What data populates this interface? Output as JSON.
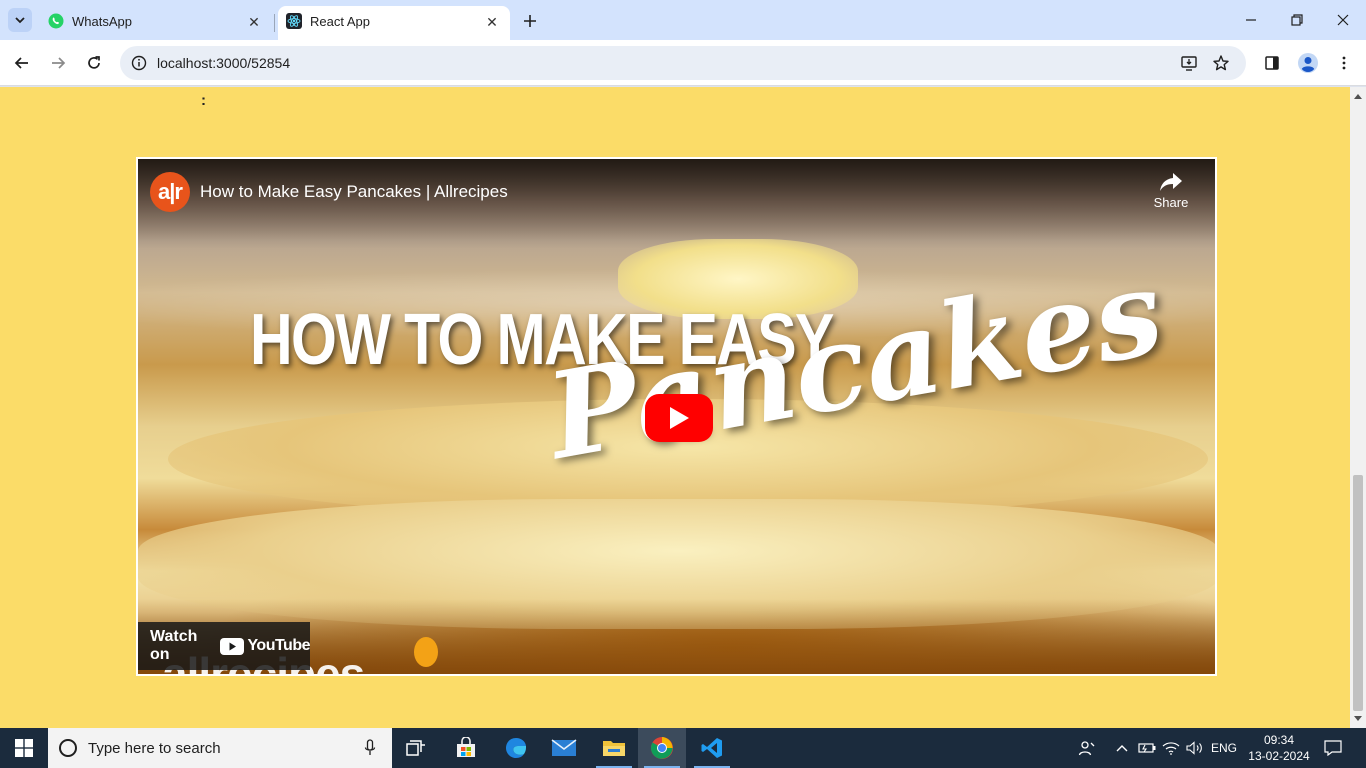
{
  "browser": {
    "tabs": [
      {
        "title": "WhatsApp",
        "favicon": "whatsapp-icon",
        "active": false
      },
      {
        "title": "React App",
        "favicon": "react-icon",
        "active": true
      }
    ],
    "url": "localhost:3000/52854"
  },
  "page": {
    "colon_text": ":",
    "background_color": "#fbdc68"
  },
  "video": {
    "channel_logo_text": "a|r",
    "title": "How to Make Easy Pancakes | Allrecipes",
    "share_label": "Share",
    "thumbnail_line1": "HOW TO MAKE EASY",
    "thumbnail_line2": "Pancakes",
    "watch_on_label": "Watch on",
    "youtube_word": "YouTube",
    "brand_watermark": "allrecipes"
  },
  "taskbar": {
    "search_placeholder": "Type here to search",
    "language": "ENG",
    "time": "09:34",
    "date": "13-02-2024",
    "apps": [
      "task-view-icon",
      "store-icon",
      "edge-icon",
      "mail-icon",
      "file-explorer-icon",
      "chrome-icon",
      "vscode-icon"
    ]
  }
}
